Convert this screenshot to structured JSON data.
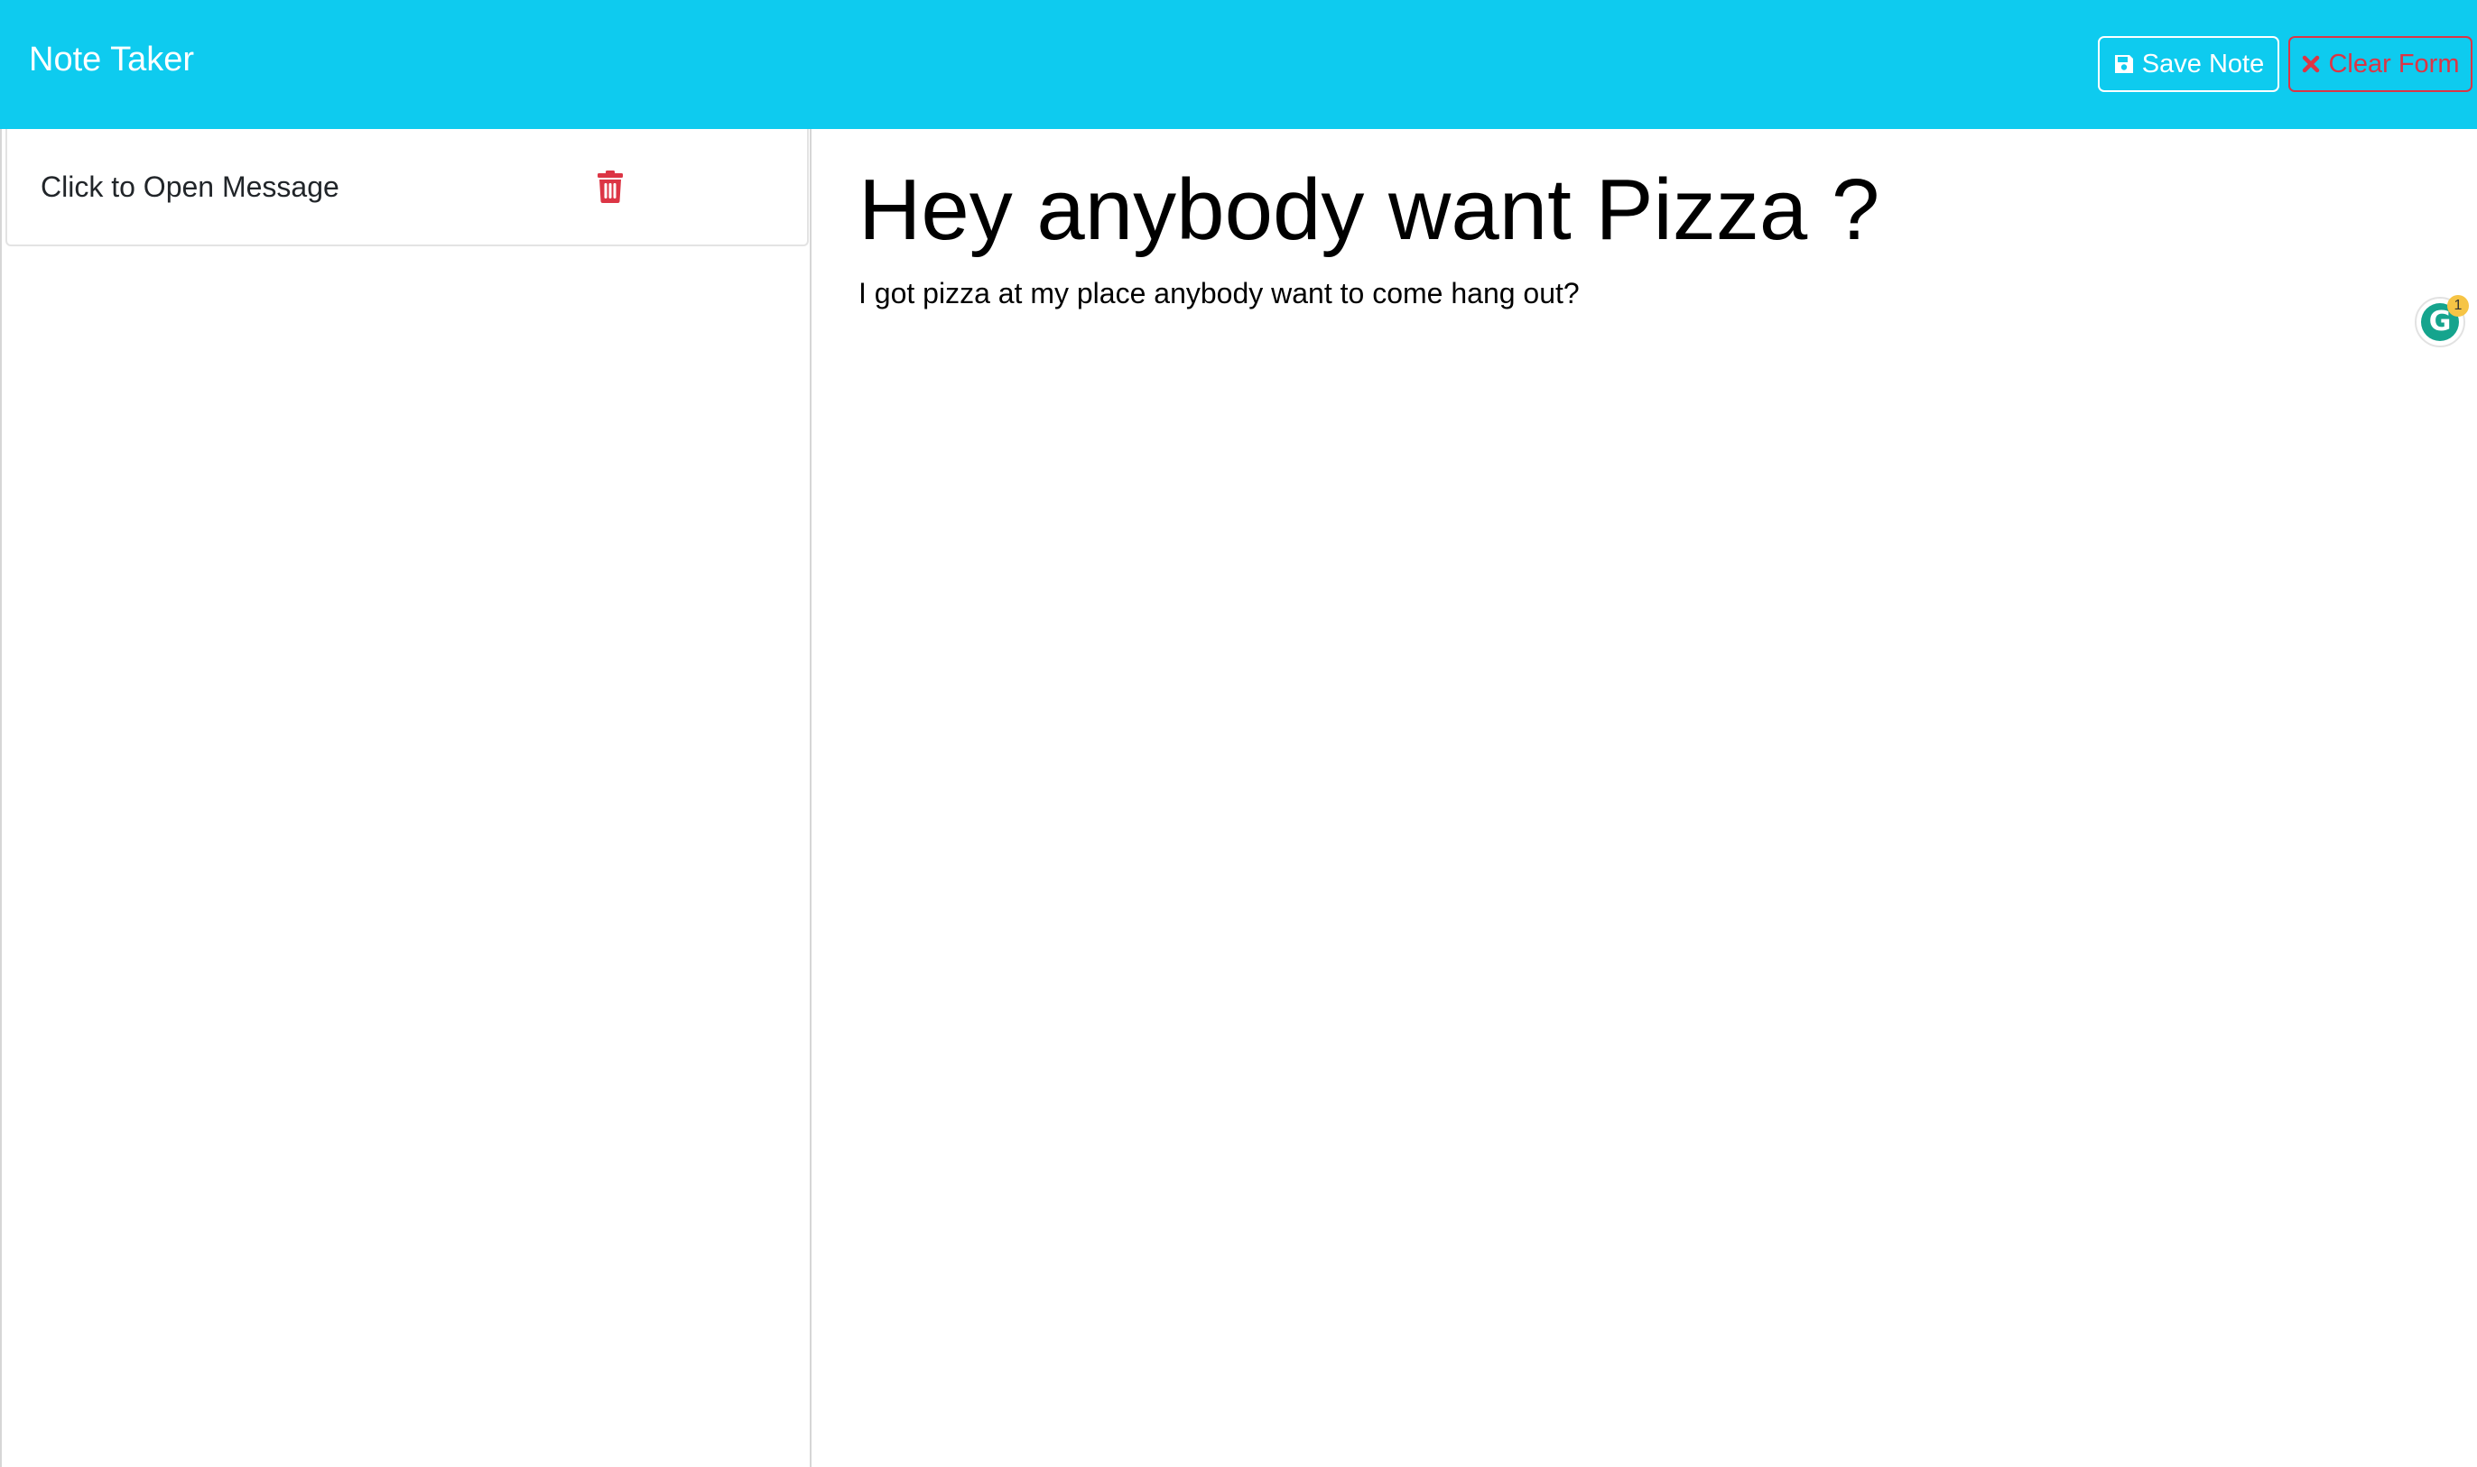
{
  "navbar": {
    "brand": "Note Taker",
    "save_label": "Save Note",
    "clear_label": "Clear Form",
    "save_icon": "floppy-disk-icon",
    "clear_icon": "x-icon"
  },
  "notes_list": {
    "items": [
      {
        "title": "Click to Open Message",
        "delete_icon": "trash-icon"
      }
    ]
  },
  "note": {
    "title": "Hey anybody want Pizza ?",
    "text": "I got pizza at my place anybody want to come hang out?"
  },
  "grammarly": {
    "letter": "G",
    "badge_count": "1"
  },
  "colors": {
    "navbar_bg": "#0ecbef",
    "danger": "#dc3545",
    "grammarly_green": "#15a48d",
    "badge_yellow": "#f6c445"
  }
}
